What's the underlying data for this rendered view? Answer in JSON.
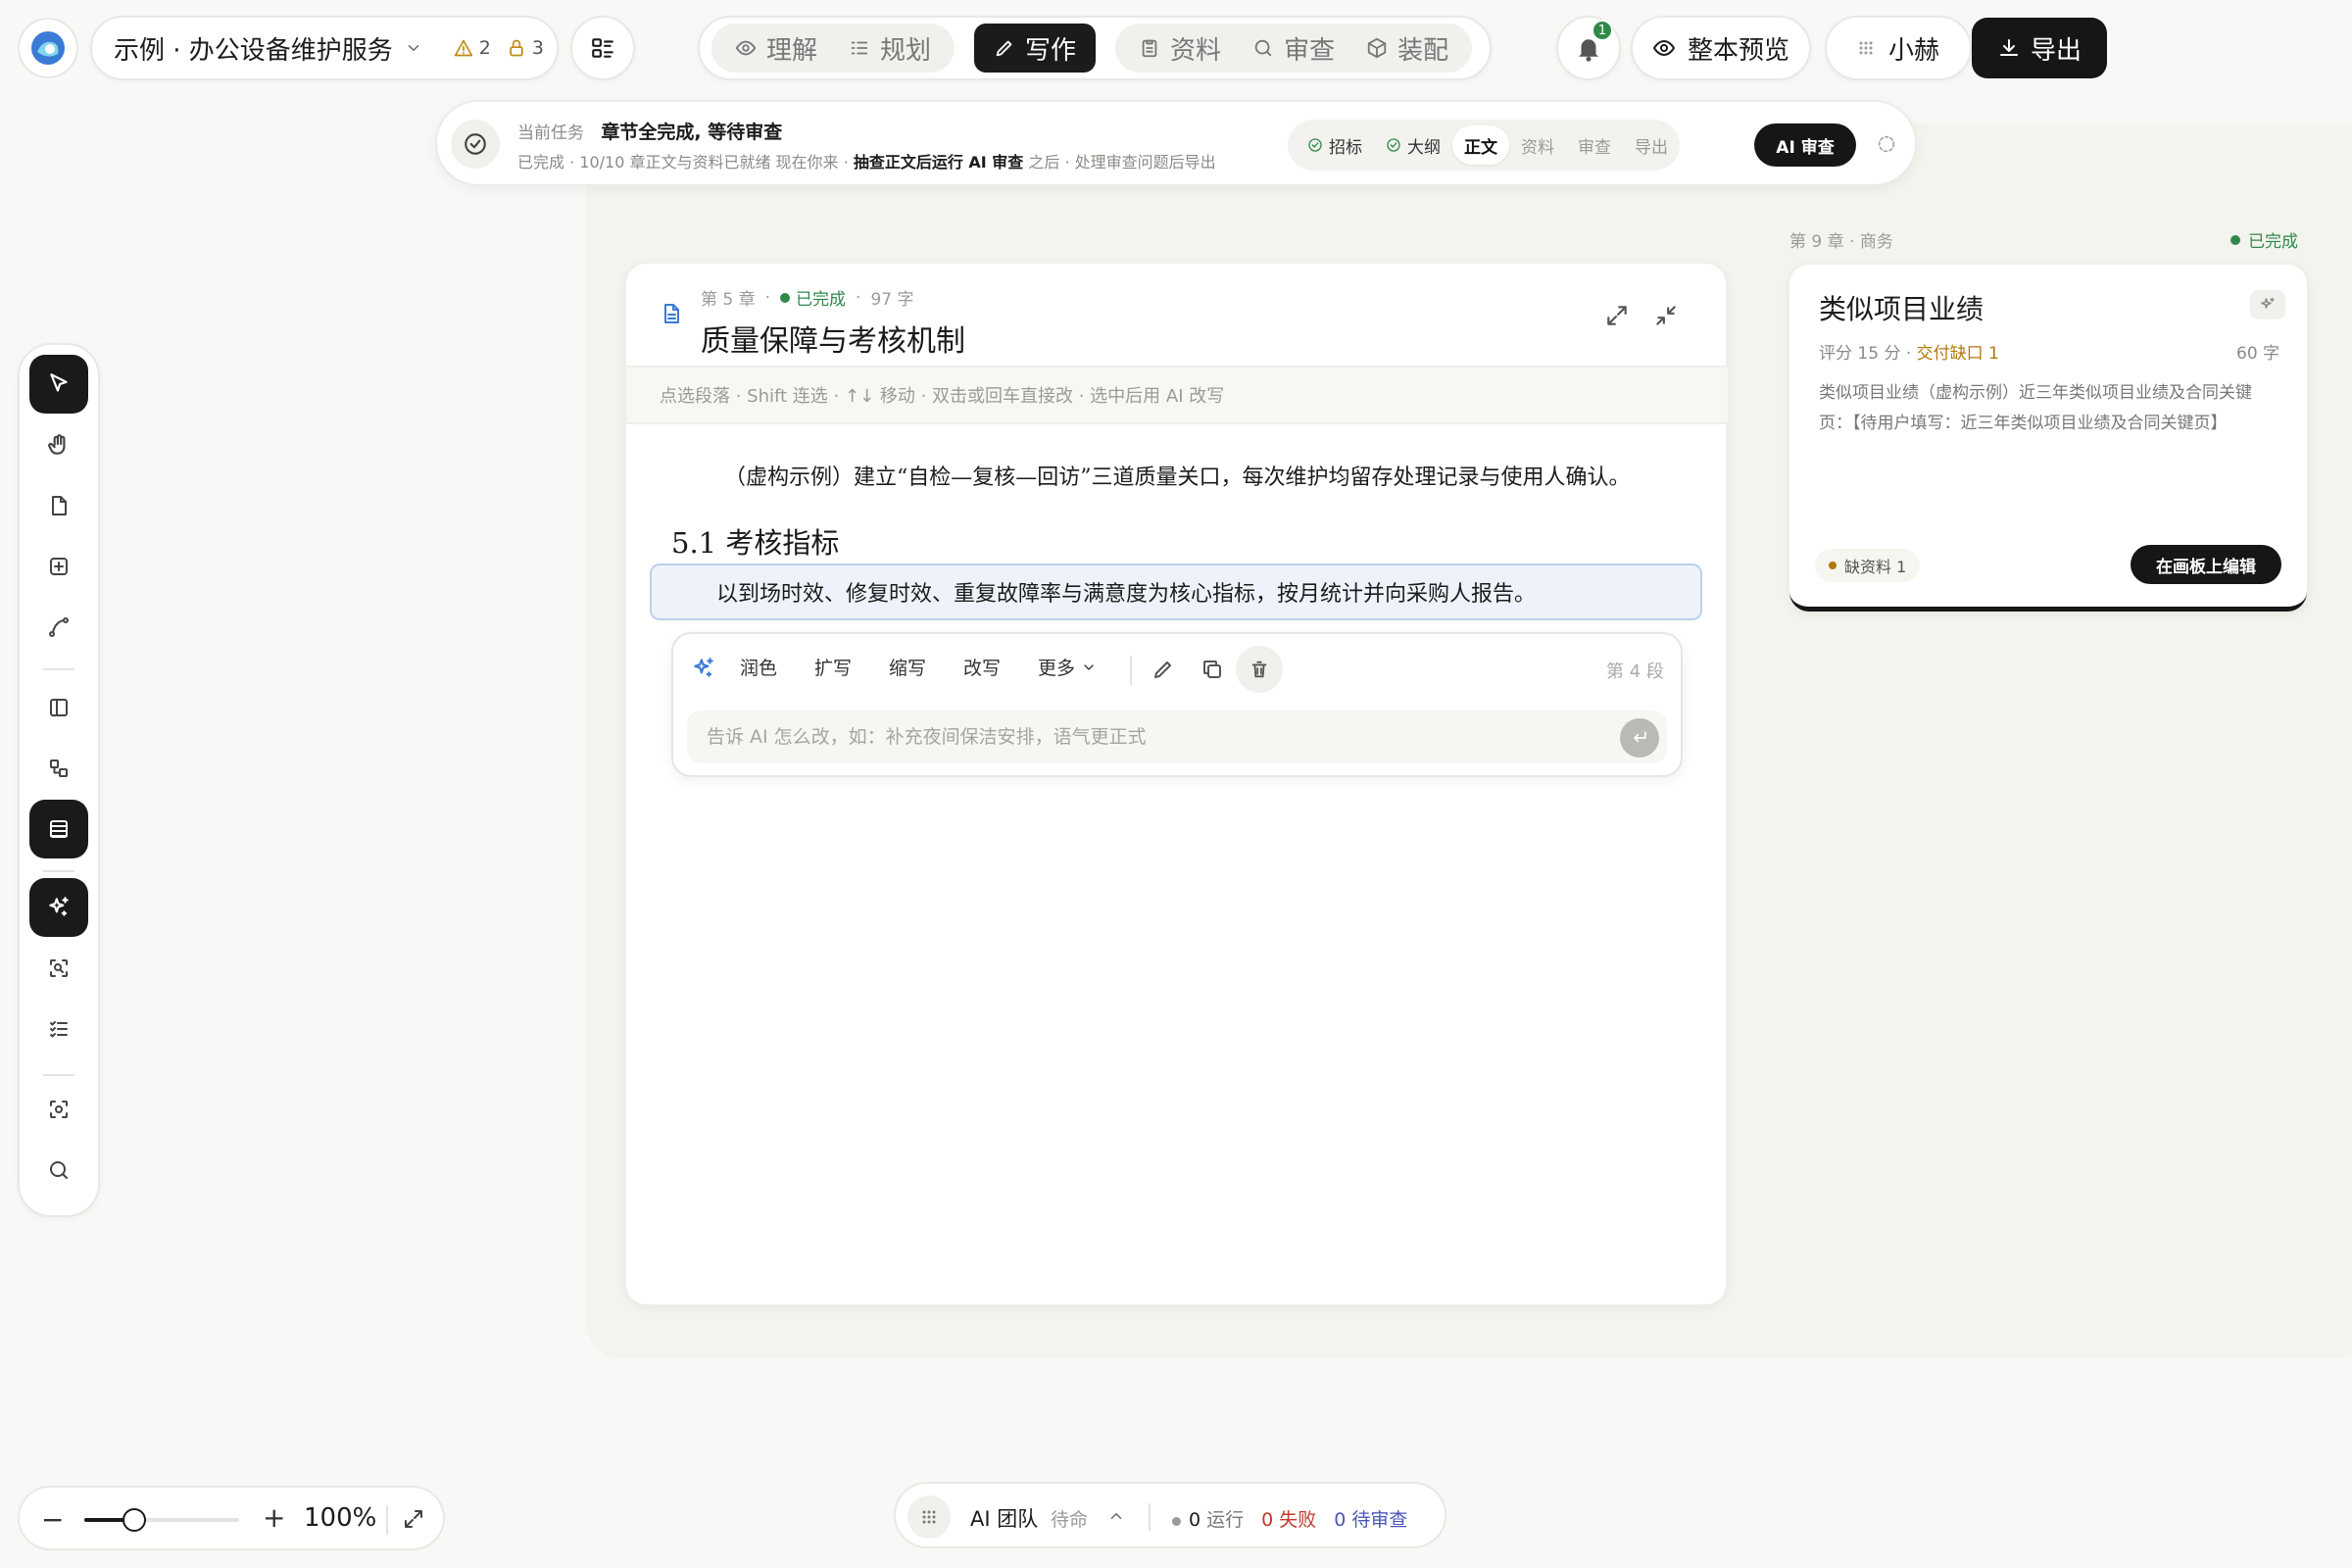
{
  "project": {
    "name": "示例 · 办公设备维护服务",
    "warnings": "2",
    "locks": "3"
  },
  "modes": [
    {
      "label": "理解",
      "icon": "eye-icon"
    },
    {
      "label": "规划",
      "icon": "list-icon"
    },
    {
      "label": "写作",
      "icon": "pencil-icon",
      "active": true
    },
    {
      "label": "资料",
      "icon": "clipboard-icon"
    },
    {
      "label": "审查",
      "icon": "search-icon"
    },
    {
      "label": "装配",
      "icon": "package-icon"
    }
  ],
  "header": {
    "notifications": "1",
    "preview_label": "整本预览",
    "user_name": "小赫",
    "export_label": "导出"
  },
  "task": {
    "label": "当前任务",
    "title": "章节全完成, 等待审查",
    "sub_prefix": "已完成 · 10/10 章正文与资料已就绪   现在你来 · ",
    "sub_action": "抽查正文后运行 AI 审查",
    "sub_suffix": "  之后 · 处理审查问题后导出",
    "steps": [
      {
        "label": "招标",
        "state": "done"
      },
      {
        "label": "大纲",
        "state": "done"
      },
      {
        "label": "正文",
        "state": "current"
      },
      {
        "label": "资料",
        "state": "todo"
      },
      {
        "label": "审查",
        "state": "todo"
      },
      {
        "label": "导出",
        "state": "todo"
      }
    ],
    "ai_review_label": "AI 审查"
  },
  "chapter": {
    "number": "第 5 章",
    "status": "已完成",
    "words": "97 字",
    "title": "质量保障与考核机制",
    "hint": "点选段落 · Shift 连选 · ↑↓ 移动 · 双击或回车直接改 · 选中后用 AI 改写",
    "paragraph1": "（虚构示例）建立“自检—复核—回访”三道质量关口，每次维护均留存处理记录与使用人确认。",
    "heading": "5.1 考核指标",
    "paragraph2": "以到场时效、修复时效、重复故障率与满意度为核心指标，按月统计并向采购人报告。"
  },
  "ai_edit": {
    "actions": [
      "润色",
      "扩写",
      "缩写",
      "改写"
    ],
    "more_label": "更多",
    "paragraph_label": "第 4 段",
    "placeholder": "告诉 AI 怎么改，如：补充夜间保洁安排，语气更正式"
  },
  "side_card": {
    "meta": "第 9 章 · 商务",
    "status": "已完成",
    "title": "类似项目业绩",
    "score": "评分 15 分",
    "gap": "交付缺口 1",
    "words": "60 字",
    "body": "类似项目业绩（虚构示例）近三年类似项目业绩及合同关键页：【待用户填写：近三年类似项目业绩及合同关键页】",
    "missing": "缺资料 1",
    "edit_label": "在画板上编辑"
  },
  "toolbar": [
    {
      "name": "select-tool",
      "icon": "cursor-icon",
      "active": true
    },
    {
      "name": "hand-tool",
      "icon": "hand-icon"
    },
    {
      "name": "page-tool",
      "icon": "page-icon"
    },
    {
      "name": "add-tool",
      "icon": "plus-square-icon"
    },
    {
      "name": "connector-tool",
      "icon": "curve-icon"
    },
    {
      "name": "panel-tool",
      "icon": "sidebar-icon"
    },
    {
      "name": "shapes-tool",
      "icon": "shapes-icon"
    },
    {
      "name": "table-tool",
      "icon": "table-icon",
      "active": true
    },
    {
      "name": "ai-tool",
      "icon": "sparkle-icon",
      "active": true
    },
    {
      "name": "scan-tool",
      "icon": "scan-search-icon"
    },
    {
      "name": "checklist-tool",
      "icon": "checklist-icon"
    },
    {
      "name": "focus-tool",
      "icon": "focus-icon"
    },
    {
      "name": "search-tool",
      "icon": "search-icon"
    }
  ],
  "zoom": {
    "value": "100%",
    "level": 0.32
  },
  "team": {
    "name": "AI 团队",
    "state": "待命",
    "running": "0",
    "running_label": "运行",
    "failed": "0",
    "failed_label": "失败",
    "review": "0",
    "review_label": "待审查"
  },
  "colors": {
    "accent_dark": "#161616",
    "success": "#2f8a4a",
    "warning": "#b3780c",
    "link_blue": "#3a7bd5"
  }
}
